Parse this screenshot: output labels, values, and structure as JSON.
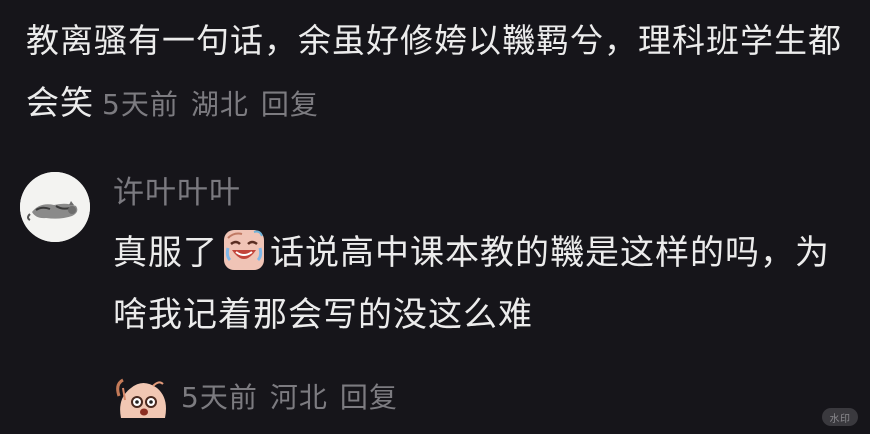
{
  "top_comment": {
    "text": "教离骚有一句话，余虽好修姱以鞿羁兮，理科班学生都会笑",
    "time": "5天前",
    "location": "湖北",
    "reply_label": "回复"
  },
  "reply": {
    "username": "许叶叶叶",
    "text_before_emoji": "真服了",
    "text_after_emoji": "话说高中课本教的鞿是这样的吗，为啥我记着那会写的没这么难",
    "emoji": "crying-laughing-face-icon",
    "sticker": "shocked-dog-sticker-icon",
    "time": "5天前",
    "location": "河北",
    "reply_label": "回复"
  },
  "watermark": "水印",
  "colors": {
    "background": "#16151a",
    "text_primary": "#ececec",
    "text_secondary": "#7c7b80"
  }
}
